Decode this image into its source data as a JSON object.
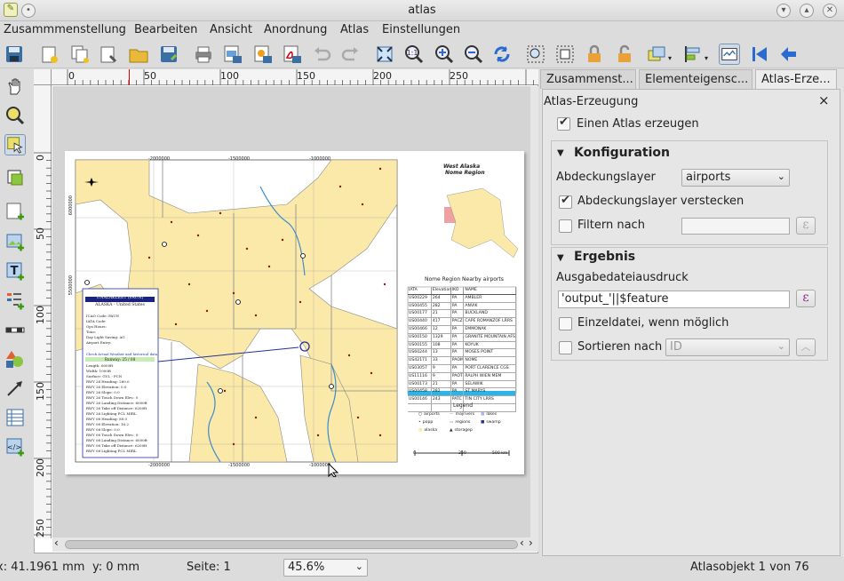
{
  "window": {
    "title": "atlas"
  },
  "menu": [
    "Zusammmenstellung",
    "Bearbeiten",
    "Ansicht",
    "Anordnung",
    "Atlas",
    "Einstellungen"
  ],
  "toolbar_more": "»",
  "ruler": {
    "h_labels": [
      "0",
      "50",
      "100",
      "150",
      "200",
      "250"
    ],
    "v_labels": [
      "0",
      "50",
      "100",
      "150",
      "200",
      "250"
    ]
  },
  "tabs": [
    "Zusammenst...",
    "Elementeigensc...",
    "Atlas-Erze..."
  ],
  "atlas": {
    "panel_title": "Atlas-Erzeugung",
    "close": "×",
    "generate_label": "Einen Atlas erzeugen",
    "config_title": "Konfiguration",
    "coverage_label": "Abdeckungslayer",
    "coverage_value": "airports",
    "hide_coverage_label": "Abdeckungslayer verstecken",
    "filter_label": "Filtern nach",
    "filter_value": "",
    "output_title": "Ergebnis",
    "output_expr_label": "Ausgabedateiausdruck",
    "output_expr_value": "'output_'||$feature",
    "single_file_label": "Einzeldatei, wenn möglich",
    "sort_label": "Sortieren nach",
    "sort_value": "ID",
    "eps": "ε"
  },
  "status": {
    "x": "x: 41.1961 mm",
    "y": "y: 0 mm",
    "page": "Seite: 1",
    "zoom": "45.6%",
    "atlas_obj": "Atlasobjekt 1 von 76"
  },
  "map": {
    "x_ticks": [
      "-2000000",
      "-1500000",
      "-1000000"
    ],
    "y_ticks": [
      "6000000",
      "5500000"
    ],
    "region_title": "West Alaska",
    "region_sub": "Nome Region",
    "table_title": "Nome Region Nearby airports",
    "table_head": [
      "IATA",
      "Elevation",
      "IKO",
      "NAME"
    ],
    "table_rows": [
      [
        "US00229",
        "264",
        "PA",
        "AMBLER"
      ],
      [
        "US00455",
        "282",
        "PA",
        "ANVIK"
      ],
      [
        "US00177",
        "21",
        "PA",
        "BUCKLAND"
      ],
      [
        "US00440",
        "417",
        "PACZ",
        "CAPE ROMANZOF LRRS"
      ],
      [
        "US00466",
        "12",
        "PA",
        "EMMONAK"
      ],
      [
        "US00150",
        "1329",
        "PA",
        "GRANITE MOUNTAIN AFS"
      ],
      [
        "US00155",
        "108",
        "PA",
        "KOYUK"
      ],
      [
        "US60244",
        "13",
        "PA",
        "MOSES POINT"
      ],
      [
        "US42171",
        "33",
        "PAOM",
        "NOME"
      ],
      [
        "US03057",
        "9",
        "PA",
        "PORT CLARENCE CGS"
      ],
      [
        "US11116",
        "9",
        "PAOT",
        "RALPH WIEN MEM"
      ],
      [
        "US00173",
        "21",
        "PA",
        "SELAWIK"
      ],
      [
        "US00458",
        "282",
        "PA",
        "ST MARYS"
      ],
      [
        "US00146",
        "243",
        "PATC",
        "TIN CITY LRRS"
      ],
      [
        "US00436",
        "19",
        "PAUN",
        "UNALAKLEET"
      ]
    ],
    "legend_title": "Legend",
    "legend_items": [
      "airports",
      "majrivers",
      "lakes",
      "popp",
      "regions",
      "swamp",
      "alaska",
      "storagep"
    ],
    "scale_labels": [
      "0",
      "250",
      "500 km"
    ],
    "info_title": "UNALAKLEET (PAUN)",
    "info_sub": "ALASKA - United States",
    "info_lines": [
      "ICAO Code: PAUN",
      "IATA Code:",
      "Ops Hours:",
      "Tone:",
      "Day Light Saving: AG",
      "Airport Entry:"
    ],
    "info_link": "Check Actual Weather and historical data",
    "info_runway": "Runway: 25 / 08",
    "info_more": [
      "Length: 6000ft",
      "Width: 1000ft",
      "Surface: GVL - PCN",
      "RWY 26 Heading: 260.0",
      "RWY 26 Elevation: 0.0",
      "RWY 26 Slope: 0.0",
      "RWY 26 Touch Down Elev.: 0",
      "RWY 26 Landing Distance: 6000ft",
      "RWY 26 Take off Distance: 6200ft",
      "RWY 26 Lighting PCL MIRL",
      "RWY 08 Heading: 80.0",
      "RWY 08 Elevation: 16.2",
      "RWY 08 Slope: 0.0",
      "RWY 08 Touch Down Elev.: 0",
      "RWY 08 Landing Distance: 6000ft",
      "RWY 08 Take off Distance: 6200ft",
      "RWY 08 Lighting PCL MIRL"
    ]
  },
  "colors": {
    "land": "#fbe9a9",
    "highlight": "#28b5e8",
    "accent": "#8a2b8a"
  }
}
